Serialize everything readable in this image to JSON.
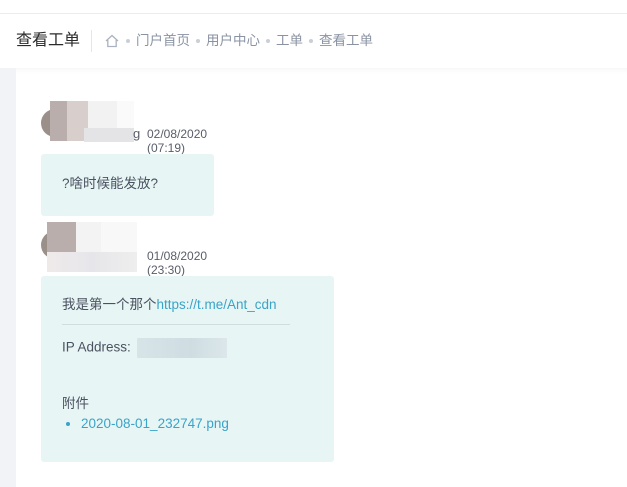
{
  "header": {
    "title": "查看工单",
    "breadcrumbs": [
      "门户首页",
      "用户中心",
      "工单",
      "查看工单"
    ]
  },
  "messages": [
    {
      "author_tail": "g",
      "timestamp": "02/08/2020 (07:19)",
      "body": "?啥时候能发放?"
    },
    {
      "timestamp": "01/08/2020 (23:30)",
      "body_text": "我是第一个那个",
      "body_link": "https://t.me/Ant_cdn",
      "ip_label": "IP Address:",
      "attachments_label": "附件",
      "attachments": [
        "2020-08-01_232747.png"
      ]
    }
  ],
  "colors": {
    "bubble_bg": "#e7f6f5",
    "link": "#3aa3c8"
  }
}
